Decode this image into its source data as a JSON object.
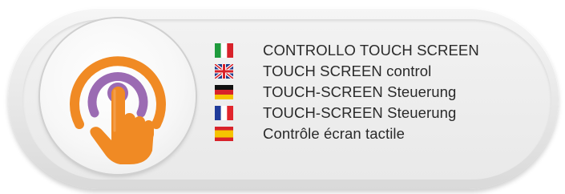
{
  "colors": {
    "accent_orange": "#f08a24",
    "accent_purple": "#9b6bb3"
  },
  "icon": {
    "name": "touch-hand-icon"
  },
  "languages": [
    {
      "flag": "italy-flag-icon",
      "text": "CONTROLLO TOUCH SCREEN"
    },
    {
      "flag": "uk-flag-icon",
      "text": "TOUCH SCREEN control"
    },
    {
      "flag": "germany-flag-icon",
      "text": "TOUCH-SCREEN Steuerung"
    },
    {
      "flag": "france-flag-icon",
      "text": "TOUCH-SCREEN Steuerung"
    },
    {
      "flag": "spain-flag-icon",
      "text": "Contrôle écran tactile"
    }
  ]
}
